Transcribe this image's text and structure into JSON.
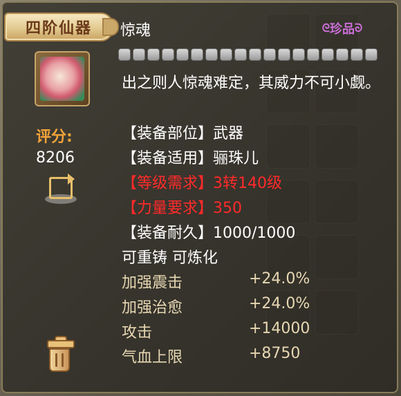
{
  "tier_tag": "四阶仙器",
  "item_name": "惊魂",
  "rarity": "珍品",
  "slot_count": 18,
  "description": "出之则人惊魂难定，其威力不可小觑。",
  "score": {
    "label": "评分:",
    "value": "8206"
  },
  "info_lines": [
    {
      "text": "【装备部位】武器",
      "color": "white"
    },
    {
      "text": "【装备适用】骊珠儿",
      "color": "white"
    },
    {
      "text": "【等级需求】3转140级",
      "color": "red"
    },
    {
      "text": "【力量要求】350",
      "color": "red"
    },
    {
      "text": "【装备耐久】1000/1000",
      "color": "white"
    },
    {
      "text": "可重铸 可炼化",
      "color": "white"
    }
  ],
  "attributes": [
    {
      "name": "加强震击",
      "value": "+24.0%"
    },
    {
      "name": "加强治愈",
      "value": "+24.0%"
    },
    {
      "name": "攻击",
      "value": "+14000"
    },
    {
      "name": "气血上限",
      "value": "+8750"
    }
  ],
  "icons": {
    "item": "flower-weapon-icon",
    "share": "share-icon",
    "trash": "trash-icon"
  },
  "colors": {
    "score_label": "#f2a33a",
    "requirement_red": "#ff2a2a",
    "rarity_purple": "#c96ed6",
    "attribute_beige": "#e7d7b3"
  }
}
